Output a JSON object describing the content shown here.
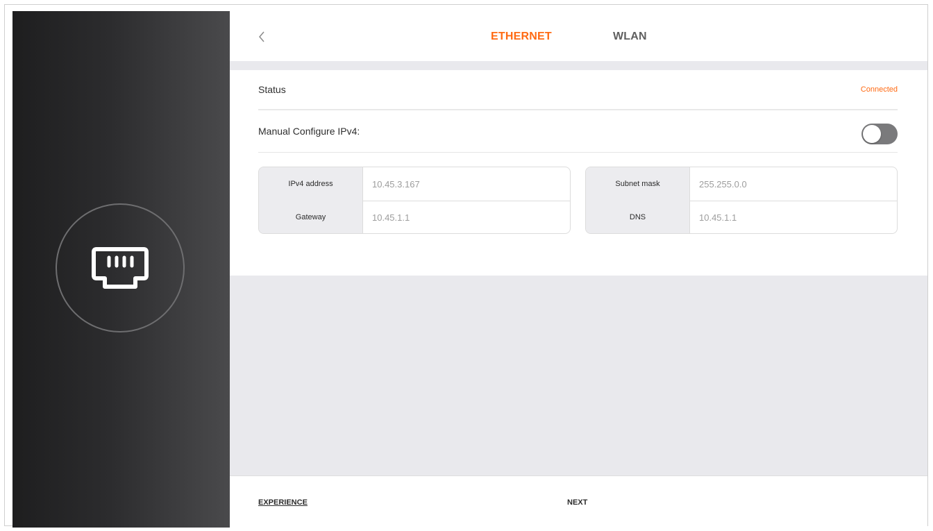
{
  "header": {
    "tabs": [
      {
        "label": "ETHERNET",
        "active": true
      },
      {
        "label": "WLAN",
        "active": false
      }
    ]
  },
  "status": {
    "label": "Status",
    "value": "Connected"
  },
  "manual_config": {
    "label": "Manual Configure IPv4:",
    "enabled": false
  },
  "network": {
    "ipv4_address": {
      "label": "IPv4 address",
      "value": "10.45.3.167"
    },
    "subnet_mask": {
      "label": "Subnet mask",
      "value": "255.255.0.0"
    },
    "gateway": {
      "label": "Gateway",
      "value": "10.45.1.1"
    },
    "dns": {
      "label": "DNS",
      "value": "10.45.1.1"
    }
  },
  "footer": {
    "experience_label": "EXPERIENCE",
    "next_label": "NEXT"
  },
  "colors": {
    "accent": "#ff6a13",
    "toggle_off": "#7a7a7c",
    "band": "#e9e9ed"
  },
  "icons": {
    "sidebar": "ethernet-port-icon",
    "back": "chevron-left-icon"
  }
}
